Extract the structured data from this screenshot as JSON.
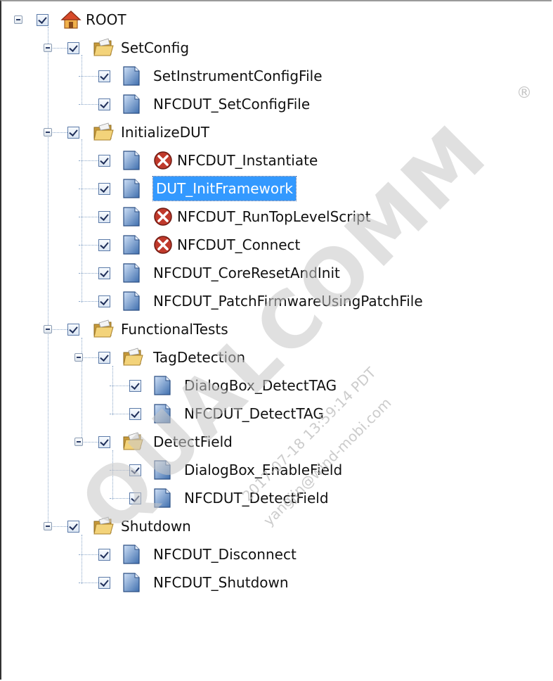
{
  "tree": {
    "nodes": [
      {
        "label": "ROOT",
        "icon": "home-icon",
        "level": 0,
        "expanded": true
      },
      {
        "label": "SetConfig",
        "icon": "folder-open-icon",
        "level": 1,
        "expanded": true
      },
      {
        "label": "SetInstrumentConfigFile",
        "icon": "document-icon",
        "level": 2
      },
      {
        "label": "NFCDUT_SetConfigFile",
        "icon": "document-icon",
        "level": 2
      },
      {
        "label": "InitializeDUT",
        "icon": "folder-open-icon",
        "level": 1,
        "expanded": true
      },
      {
        "label": "NFCDUT_Instantiate",
        "icon": "document-icon",
        "level": 2,
        "error": true
      },
      {
        "label": "DUT_InitFramework",
        "icon": "document-icon",
        "level": 2,
        "selected": true
      },
      {
        "label": "NFCDUT_RunTopLevelScript",
        "icon": "document-icon",
        "level": 2,
        "error": true
      },
      {
        "label": "NFCDUT_Connect",
        "icon": "document-icon",
        "level": 2,
        "error": true
      },
      {
        "label": "NFCDUT_CoreResetAndInit",
        "icon": "document-icon",
        "level": 2
      },
      {
        "label": "NFCDUT_PatchFirmwareUsingPatchFile",
        "icon": "document-icon",
        "level": 2
      },
      {
        "label": "FunctionalTests",
        "icon": "folder-open-icon",
        "level": 1,
        "expanded": true
      },
      {
        "label": "TagDetection",
        "icon": "folder-open-icon",
        "level": 2,
        "expanded": true
      },
      {
        "label": "DialogBox_DetectTAG",
        "icon": "document-icon",
        "level": 3
      },
      {
        "label": "NFCDUT_DetectTAG",
        "icon": "document-icon",
        "level": 3
      },
      {
        "label": "DetectField",
        "icon": "folder-open-icon",
        "level": 2,
        "expanded": true
      },
      {
        "label": "DialogBox_EnableField",
        "icon": "document-icon",
        "level": 3
      },
      {
        "label": "NFCDUT_DetectField",
        "icon": "document-icon",
        "level": 3
      },
      {
        "label": "Shutdown",
        "icon": "folder-open-icon",
        "level": 1,
        "expanded": true
      },
      {
        "label": "NFCDUT_Disconnect",
        "icon": "document-icon",
        "level": 2
      },
      {
        "label": "NFCDUT_Shutdown",
        "icon": "document-icon",
        "level": 2
      }
    ]
  },
  "watermark": {
    "brand": "QUALCOMM",
    "registered": "®",
    "timestamp": "2017-07-18 13:59:14 PDT",
    "email": "yangjin@wind-mobi.com"
  },
  "colors": {
    "selection": "#3399ff",
    "error": "#c0392b",
    "folder": "#e9c46a",
    "document": "#4a7fc1"
  }
}
